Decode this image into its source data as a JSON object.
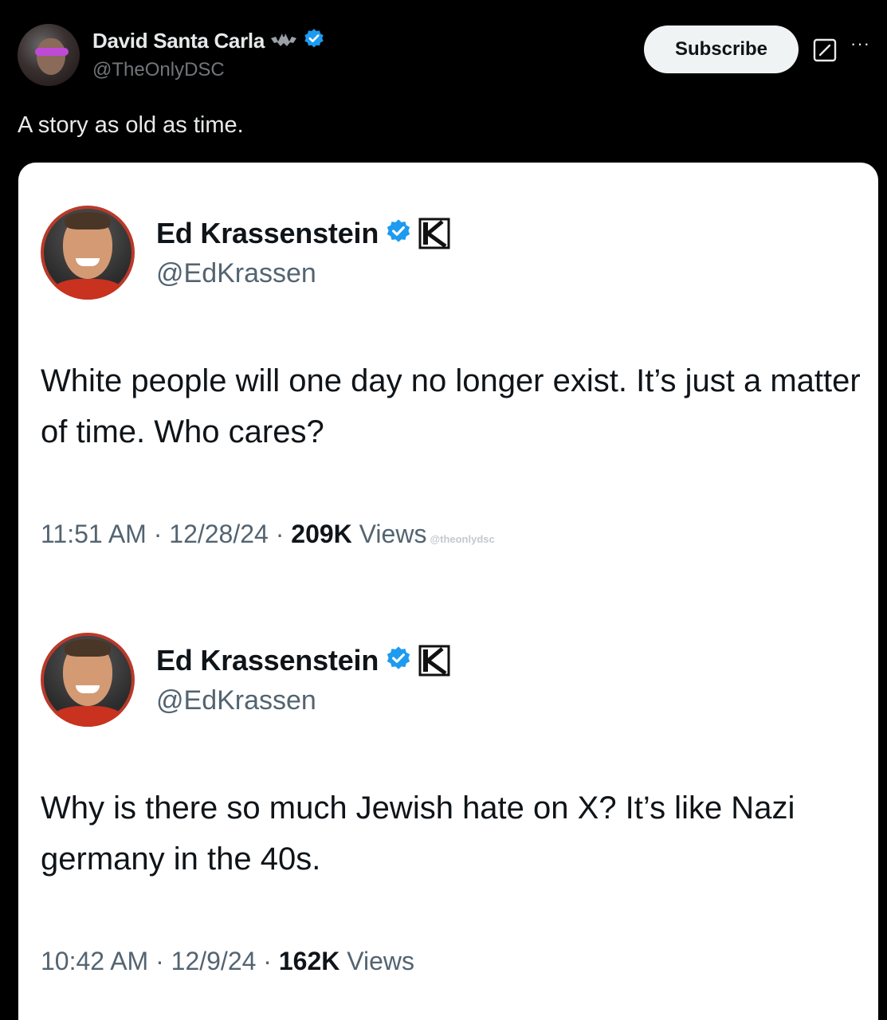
{
  "post": {
    "author_name": "David Santa Carla",
    "author_handle": "@TheOnlyDSC",
    "subscribe_label": "Subscribe",
    "more_label": "···",
    "text": "A story as old as time."
  },
  "embedded_tweets": [
    {
      "author_name": "Ed Krassenstein",
      "author_handle": "@EdKrassen",
      "affiliate_badge": "K",
      "text": "White people will one day no longer exist. It’s just a matter of time. Who cares?",
      "time": "11:51 AM",
      "date": "12/28/24",
      "views_count": "209K",
      "views_label": "Views",
      "watermark": "@theonlydsc"
    },
    {
      "author_name": "Ed Krassenstein",
      "author_handle": "@EdKrassen",
      "affiliate_badge": "K",
      "text": "Why is there so much Jewish hate on X?  It’s like Nazi germany in the 40s.",
      "time": "10:42 AM",
      "date": "12/9/24",
      "views_count": "162K",
      "views_label": "Views"
    }
  ],
  "colors": {
    "background": "#000000",
    "verified_blue": "#1d9bf0",
    "card_background": "#ffffff",
    "secondary_text": "#536471"
  },
  "icons": {
    "verified": "verified-badge-icon",
    "affiliate": "affiliate-k-icon",
    "grok": "grok-icon",
    "more": "more-icon",
    "bat": "bat-icon"
  }
}
